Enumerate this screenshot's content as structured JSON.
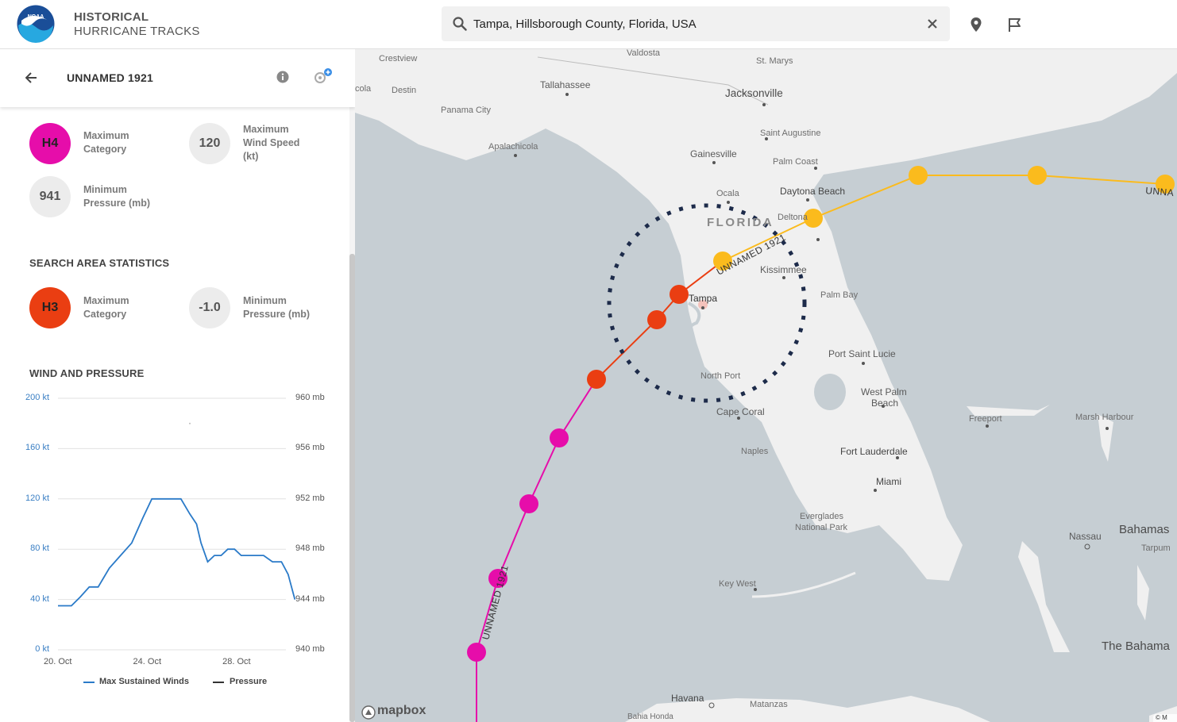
{
  "header": {
    "title_line1": "HISTORICAL",
    "title_line2": "HURRICANE TRACKS",
    "logo_text": "NOAA",
    "search_value": "Tampa, Hillsborough County, Florida, USA",
    "icons": [
      "search-icon",
      "close-icon",
      "location-pin-icon",
      "flag-icon"
    ]
  },
  "panel": {
    "storm_name": "UNNAMED 1921",
    "storm_stats": [
      {
        "value": "H4",
        "label": "Maximum Category",
        "color": "#e60daa"
      },
      {
        "value": "120",
        "label": "Maximum Wind Speed (kt)",
        "color": "#ececec"
      },
      {
        "value": "941",
        "label": "Minimum Pressure (mb)",
        "color": "#ececec"
      }
    ],
    "search_area_title": "SEARCH AREA STATISTICS",
    "search_stats": [
      {
        "value": "H3",
        "label": "Maximum Category",
        "color": "#ea3e12"
      },
      {
        "value": "-1.0",
        "label": "Minimum Pressure (mb)",
        "color": "#ececec"
      }
    ],
    "wind_pressure_title": "WIND AND PRESSURE",
    "legend": {
      "winds": "Max Sustained Winds",
      "pressure": "Pressure"
    }
  },
  "chart_data": {
    "type": "line",
    "title": "WIND AND PRESSURE",
    "x_ticks": [
      "20. Oct",
      "24. Oct",
      "28. Oct"
    ],
    "y_left_ticks": [
      "200 kt",
      "160 kt",
      "120 kt",
      "80 kt",
      "40 kt",
      "0 kt"
    ],
    "y_right_ticks": [
      "960 mb",
      "956 mb",
      "952 mb",
      "948 mb",
      "944 mb",
      "940 mb"
    ],
    "ylim_left": [
      0,
      200
    ],
    "ylim_right": [
      940,
      960
    ],
    "xlim_days": [
      20,
      30.2
    ],
    "series": [
      {
        "name": "Max Sustained Winds",
        "color": "#2a7ac8",
        "points": [
          [
            20.0,
            35
          ],
          [
            20.6,
            35
          ],
          [
            21.0,
            42
          ],
          [
            21.4,
            50
          ],
          [
            21.8,
            50
          ],
          [
            22.3,
            65
          ],
          [
            22.8,
            75
          ],
          [
            23.3,
            85
          ],
          [
            23.8,
            105
          ],
          [
            24.2,
            120
          ],
          [
            24.6,
            120
          ],
          [
            25.0,
            120
          ],
          [
            25.5,
            120
          ],
          [
            25.9,
            108
          ],
          [
            26.2,
            100
          ],
          [
            26.4,
            85
          ],
          [
            26.7,
            70
          ],
          [
            27.0,
            75
          ],
          [
            27.3,
            75
          ],
          [
            27.6,
            80
          ],
          [
            27.9,
            80
          ],
          [
            28.2,
            75
          ],
          [
            28.7,
            75
          ],
          [
            29.2,
            75
          ],
          [
            29.6,
            70
          ],
          [
            30.0,
            70
          ],
          [
            30.3,
            60
          ],
          [
            30.6,
            40
          ]
        ]
      },
      {
        "name": "Pressure",
        "color": "#333333",
        "points": [
          [
            25.9,
            958
          ]
        ]
      }
    ],
    "grid": true,
    "legend_position": "bottom"
  },
  "map": {
    "track_label": "UNNAMED 1921",
    "track_label_cut": "UNNA",
    "brand": "mapbox",
    "search_radius_center": "Tampa",
    "labels": {
      "crestview": "Crestview",
      "valdosta": "Valdosta",
      "st_marys": "St. Marys",
      "tallahassee": "Tallahassee",
      "destin": "Destin",
      "cola": "cola",
      "jacksonville": "Jacksonville",
      "panama_city": "Panama City",
      "saint_augustine": "Saint Augustine",
      "apalachicola": "Apalachicola",
      "gainesville": "Gainesville",
      "palm_coast": "Palm Coast",
      "ocala": "Ocala",
      "daytona_beach": "Daytona Beach",
      "florida": "FLORIDA",
      "deltona": "Deltona",
      "kissimmee": "Kissimmee",
      "tampa": "Tampa",
      "palm_bay": "Palm Bay",
      "port_saint_lucie": "Port Saint Lucie",
      "north_port": "North Port",
      "west_palm_beach_1": "West Palm",
      "west_palm_beach_2": "Beach",
      "cape_coral": "Cape Coral",
      "freeport": "Freeport",
      "marsh_harbour": "Marsh Harbour",
      "naples": "Naples",
      "fort_lauderdale": "Fort Lauderdale",
      "miami": "Miami",
      "everglades_1": "Everglades",
      "everglades_2": "National Park",
      "nassau": "Nassau",
      "bahamas": "Bahamas",
      "tarpum": "Tarpum",
      "key_west": "Key West",
      "the_bahamas": "The Bahama",
      "havana": "Havana",
      "matanzas": "Matanzas",
      "bahia_honda": "Bahia Honda",
      "copyright": "© M"
    },
    "colors": {
      "h4": "#e60daa",
      "h3": "#ea3e12",
      "ts": "#fbbb1d",
      "radius": "#1d2b4a",
      "land": "#f0f0f0",
      "water": "#c6ced3"
    }
  }
}
